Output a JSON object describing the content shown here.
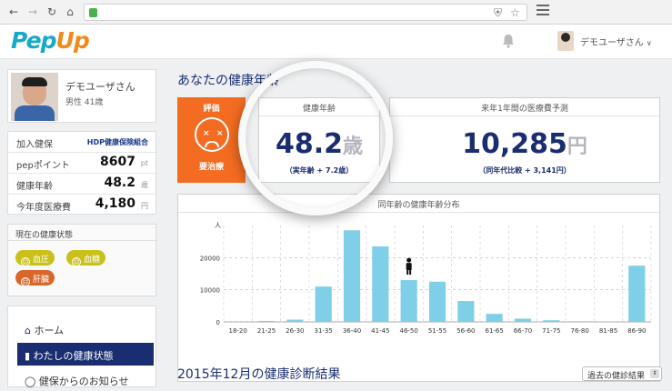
{
  "browser": {
    "menu_icon": "hamburger-icon"
  },
  "app": {
    "logo_main": "Pep",
    "logo_accent": "Up",
    "user_name": "デモユーザさん",
    "user_chevron": "∨"
  },
  "profile": {
    "name": "デモユーザさん",
    "meta": "男性 41歳"
  },
  "stats": {
    "insurance_label": "加入健保",
    "insurance_value": "HDP健康保険組合",
    "points_label": "pepポイント",
    "points_value": "8607",
    "points_unit": "pt",
    "age_label": "健康年齢",
    "age_value": "48.2",
    "age_unit": "歳",
    "cost_label": "今年度医療費",
    "cost_value": "4,180",
    "cost_unit": "円"
  },
  "health_state": {
    "title": "現在の健康状態",
    "items": [
      {
        "label": "血圧",
        "color": "#c9c01a",
        "face": "☺"
      },
      {
        "label": "血糖",
        "color": "#c9c01a",
        "face": "☺"
      },
      {
        "label": "肝臓",
        "color": "#d9662a",
        "face": "☹"
      }
    ]
  },
  "nav": {
    "home": "ホーム",
    "health": "わたしの健康状態",
    "notices": "健保からのお知らせ"
  },
  "main": {
    "section_title": "あなたの健康年齢",
    "eval_label": "評価",
    "eval_result": "要治療",
    "age_box_title": "健康年齢",
    "age_big": "48.2",
    "age_big_unit": "歳",
    "age_sub": "（実年齢 + 7.2歳）",
    "cost_box_title": "来年1年間の医療費予測",
    "cost_big": "10,285",
    "cost_big_unit": "円",
    "cost_sub": "（同年代比較 + 3,141円）",
    "chart_title": "同年齢の健康年齢分布",
    "checkup_title": "2015年12月の健康診断結果",
    "past_dropdown": "過去の健診結果"
  },
  "chart_data": {
    "type": "bar",
    "title": "同年齢の健康年齢分布",
    "ylabel": "人",
    "ylim": [
      0,
      30000
    ],
    "yticks": [
      "0",
      "10000",
      "20000"
    ],
    "categories": [
      "18-20",
      "21-25",
      "26-30",
      "31-35",
      "36-40",
      "41-45",
      "46-50",
      "51-55",
      "56-60",
      "61-65",
      "66-70",
      "71-75",
      "76-80",
      "81-85",
      "86-90"
    ],
    "values": [
      0,
      300,
      700,
      11000,
      28500,
      23500,
      13000,
      12500,
      6500,
      2500,
      1000,
      500,
      200,
      100,
      17500
    ],
    "marker_category": "46-50",
    "bar_color": "#7fcfe8",
    "grid": true
  }
}
